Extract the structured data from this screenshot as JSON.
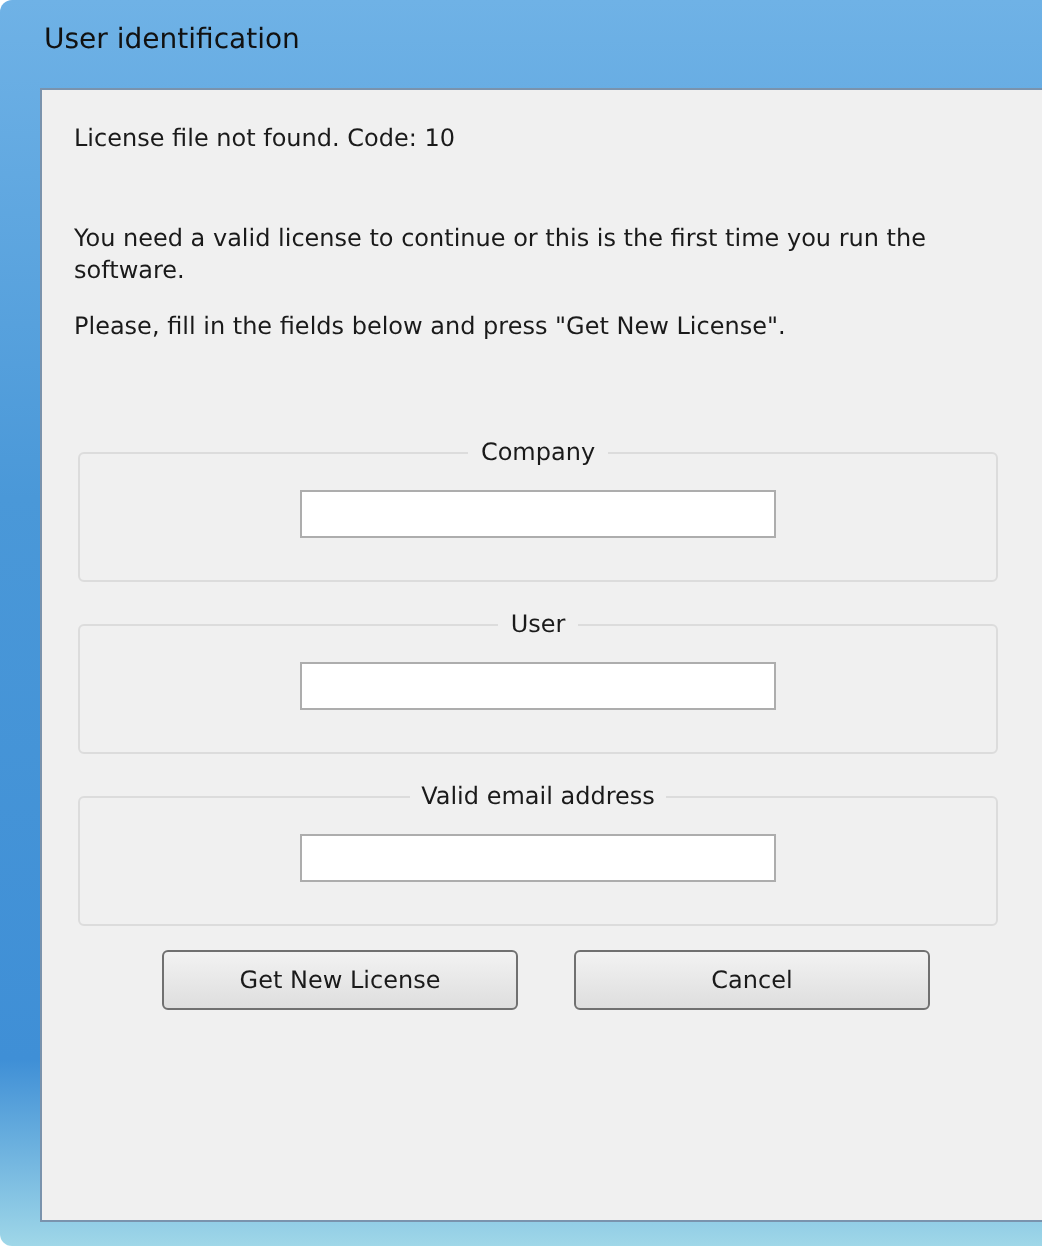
{
  "window": {
    "title": "User identification"
  },
  "messages": [
    "License file not found. Code: 10",
    "You need a valid license to continue or this is the first time you run the software.",
    "Please, fill in the fields below and press \"Get New License\"."
  ],
  "fields": [
    {
      "label": "Company"
    },
    {
      "label": "User"
    },
    {
      "label": "Valid email address"
    }
  ],
  "buttons": [
    "Get New License",
    "Cancel"
  ]
}
